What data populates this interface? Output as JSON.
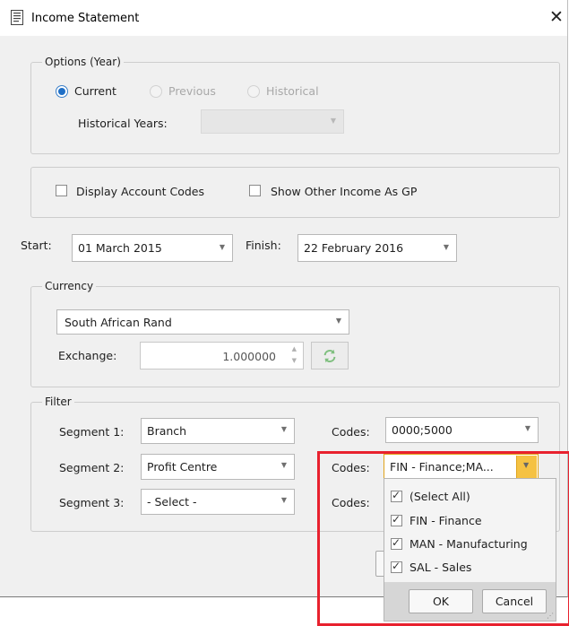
{
  "window": {
    "title": "Income Statement",
    "close_glyph": "✕"
  },
  "options": {
    "legend": "Options (Year)",
    "radios": {
      "current": "Current",
      "previous": "Previous",
      "historical": "Historical"
    },
    "selected": "current",
    "historical_years_label": "Historical Years:",
    "historical_years_value": ""
  },
  "display": {
    "account_codes_label": "Display Account Codes",
    "other_income_label": "Show Other Income As GP"
  },
  "period": {
    "start_label": "Start:",
    "start_value": "01 March 2015",
    "finish_label": "Finish:",
    "finish_value": "22 February 2016"
  },
  "currency": {
    "legend": "Currency",
    "selected": "South African Rand",
    "exchange_label": "Exchange:",
    "exchange_value": "1.000000"
  },
  "filter": {
    "legend": "Filter",
    "rows": [
      {
        "segment_label": "Segment 1:",
        "segment_value": "Branch",
        "codes_label": "Codes:",
        "codes_value": "0000;5000"
      },
      {
        "segment_label": "Segment 2:",
        "segment_value": "Profit Centre",
        "codes_label": "Codes:",
        "codes_value": "FIN - Finance;MA..."
      },
      {
        "segment_label": "Segment 3:",
        "segment_value": "- Select -",
        "codes_label": "Codes:",
        "codes_value": ""
      }
    ]
  },
  "codes_dropdown": {
    "items": [
      {
        "label": "(Select All)",
        "checked": true
      },
      {
        "label": "FIN - Finance",
        "checked": true
      },
      {
        "label": "MAN - Manufacturing",
        "checked": true
      },
      {
        "label": "SAL - Sales",
        "checked": true
      }
    ],
    "ok_label": "OK",
    "cancel_label": "Cancel"
  },
  "colors": {
    "accent": "#1f6fc6",
    "highlight": "#e8212e",
    "dropdown_button": "#f5c243"
  }
}
